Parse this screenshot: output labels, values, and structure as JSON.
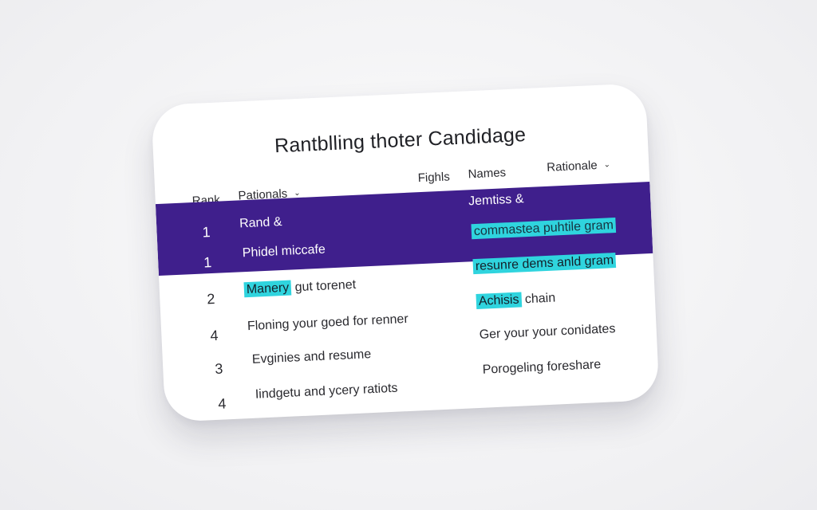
{
  "card": {
    "title": "Rantblling thoter Candidage",
    "headers": {
      "rank": "Rank",
      "pationals": "Pationals",
      "fighls": "Fighls",
      "names": "Names",
      "rationale": "Rationale"
    },
    "rows": [
      {
        "rank": "1",
        "left": "Rand &",
        "left_hl": "",
        "left_rest": "",
        "right_hl": "",
        "right_rest": "Jemtiss &"
      },
      {
        "rank": "1",
        "left": "Phidel miccafe",
        "left_hl": "",
        "left_rest": "",
        "right_hl": "commastea puhtile gram",
        "right_rest": ""
      },
      {
        "rank": "2",
        "left": "",
        "left_hl": "Manery",
        "left_rest": " gut torenet",
        "right_hl": "resunre dems anld gram",
        "right_rest": ""
      },
      {
        "rank": "4",
        "left": "Floning your goed for renner",
        "left_hl": "",
        "left_rest": "",
        "right_hl": "Achisis",
        "right_rest": " chain"
      },
      {
        "rank": "3",
        "left": "Evginies and resume",
        "left_hl": "",
        "left_rest": "",
        "right_hl": "",
        "right_rest": "Ger your your conidates"
      },
      {
        "rank": "4",
        "left": "Iindgetu and ycery ratiots",
        "left_hl": "",
        "left_rest": "",
        "right_hl": "",
        "right_rest": "Porogeling foreshare"
      }
    ]
  },
  "colors": {
    "selected_band": "#3f1f8c",
    "highlight": "#2fd4de",
    "background": "#f2f2f4"
  },
  "icons": {
    "sort_chevron": "chevron-down-icon"
  }
}
